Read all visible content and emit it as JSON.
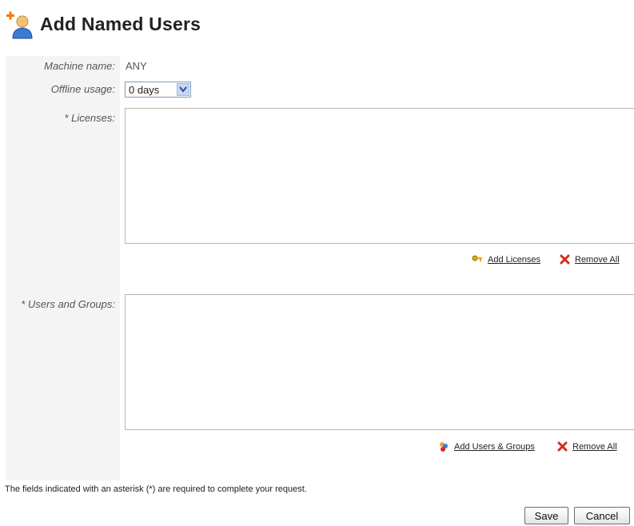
{
  "header": {
    "title": "Add Named Users",
    "icon": "add-user-icon"
  },
  "form": {
    "machine_name": {
      "label": "Machine name:",
      "value": "ANY"
    },
    "offline_usage": {
      "label": "Offline usage:",
      "selected": "0 days"
    },
    "licenses": {
      "label": "* Licenses:",
      "add_label": "Add Licenses",
      "add_icon": "key-icon",
      "remove_label": "Remove All",
      "remove_icon": "remove-icon"
    },
    "users_groups": {
      "label": "* Users and Groups:",
      "add_label": "Add Users & Groups",
      "add_icon": "users-groups-icon",
      "remove_label": "Remove All",
      "remove_icon": "remove-icon"
    },
    "required_note": "The fields indicated with an asterisk (*) are required to complete your request."
  },
  "buttons": {
    "save": "Save",
    "cancel": "Cancel"
  },
  "colors": {
    "accent": "#3a6cc6",
    "remove": "#d62b1e",
    "key": "#e0a800"
  }
}
